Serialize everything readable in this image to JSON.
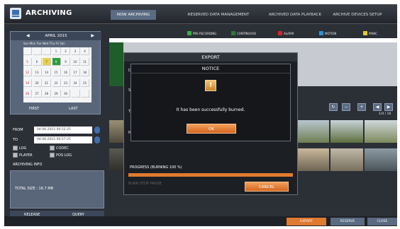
{
  "app": {
    "title": "ARCHIVING"
  },
  "tabs": [
    {
      "label": "NOW ARCHIVING"
    },
    {
      "label": "RESERVED DATA MANAGEMENT"
    },
    {
      "label": "ARCHIVED DATA PLAYBACK"
    },
    {
      "label": "ARCHIVE DEVICES SETUP"
    }
  ],
  "calendar": {
    "month": "APRIL 2015",
    "weekdays": "Sun Mon Tue Wed Thu Fri Sat",
    "days": [
      {
        "d": "",
        "r": 0
      },
      {
        "d": "",
        "r": 0
      },
      {
        "d": "",
        "r": 0
      },
      {
        "d": "1",
        "r": 0
      },
      {
        "d": "2",
        "r": 0
      },
      {
        "d": "3",
        "r": 0
      },
      {
        "d": "4",
        "r": 0
      },
      {
        "d": "5",
        "r": 1
      },
      {
        "d": "6",
        "r": 0
      },
      {
        "d": "7",
        "r": 0
      },
      {
        "d": "8",
        "r": 0,
        "sel": 1
      },
      {
        "d": "9",
        "r": 0
      },
      {
        "d": "10",
        "r": 0
      },
      {
        "d": "11",
        "r": 0
      },
      {
        "d": "12",
        "r": 1
      },
      {
        "d": "13",
        "r": 0
      },
      {
        "d": "14",
        "r": 0
      },
      {
        "d": "15",
        "r": 0
      },
      {
        "d": "16",
        "r": 0
      },
      {
        "d": "17",
        "r": 0
      },
      {
        "d": "18",
        "r": 0
      },
      {
        "d": "19",
        "r": 1
      },
      {
        "d": "20",
        "r": 0
      },
      {
        "d": "21",
        "r": 0
      },
      {
        "d": "22",
        "r": 0
      },
      {
        "d": "23",
        "r": 0
      },
      {
        "d": "24",
        "r": 0
      },
      {
        "d": "25",
        "r": 0
      },
      {
        "d": "26",
        "r": 1
      },
      {
        "d": "27",
        "r": 0
      },
      {
        "d": "28",
        "r": 0
      },
      {
        "d": "29",
        "r": 0
      },
      {
        "d": "30",
        "r": 0
      },
      {
        "d": "",
        "r": 0
      },
      {
        "d": "",
        "r": 0
      }
    ],
    "first_label": "FIRST",
    "last_label": "LAST"
  },
  "range": {
    "from_label": "FROM",
    "from_value": "04-06-2015 00:52:25",
    "to_label": "TO",
    "to_value": "04-06-2015 00:57:25"
  },
  "options": [
    {
      "label": "LOG"
    },
    {
      "label": "CODEC"
    },
    {
      "label": "PLAYER"
    },
    {
      "label": "POS LOG"
    }
  ],
  "info": {
    "title": "ARCHIVING INFO",
    "total": "TOTAL SIZE : 16.7 MB"
  },
  "left_buttons": {
    "release": "RELEASE",
    "query": "QUERY"
  },
  "legend": [
    {
      "label": "PRE RECORDING",
      "color": "#36b24a"
    },
    {
      "label": "CONTINUOUS",
      "color": "#2e7a3a"
    },
    {
      "label": "ALARM",
      "color": "#d8232a"
    },
    {
      "label": "MOTION",
      "color": "#2f8fd6"
    },
    {
      "label": "PANIC",
      "color": "#e9c92a"
    }
  ],
  "page_label": "1/4 / 16",
  "dialog": {
    "title": "EXPORT",
    "labels": [
      "DE",
      "SE",
      "TA",
      "MI"
    ],
    "progress_label": "PROGRESS (BURNING 100 %)",
    "progress": 1.0,
    "ghost_buttons": "BURN  STOP  PAUSE",
    "cancel": "CANCEL"
  },
  "notice": {
    "title": "NOTICE",
    "message": "It has been successfully burned.",
    "ok": "OK"
  },
  "bottom": {
    "export": "EXPORT",
    "reserve": "RESERVE",
    "close": "CLOSE"
  }
}
